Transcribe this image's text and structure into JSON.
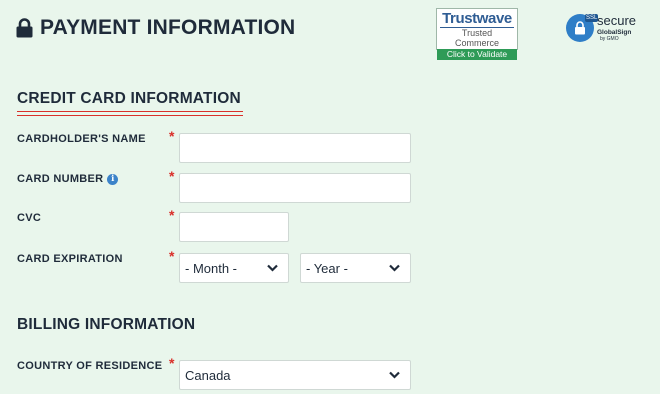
{
  "header": {
    "title": "PAYMENT INFORMATION",
    "lock_icon": "lock-icon"
  },
  "badges": {
    "trustwave": {
      "name": "Trustwave",
      "subtitle": "Trusted Commerce",
      "cta": "Click to Validate"
    },
    "globalsign": {
      "ssl": "SSL",
      "secure": "secure",
      "brand": "GlobalSign",
      "by": "by GMO"
    }
  },
  "credit_card": {
    "section_title": "CREDIT CARD INFORMATION",
    "cardholder_label": "CARDHOLDER'S NAME",
    "cardholder_value": "",
    "card_number_label": "CARD NUMBER",
    "card_number_value": "",
    "cvc_label": "CVC",
    "cvc_value": "",
    "expiration_label": "CARD EXPIRATION",
    "month_selected": "- Month -",
    "year_selected": "- Year -",
    "required_marker": "*"
  },
  "billing": {
    "section_title": "BILLING INFORMATION",
    "country_label": "COUNTRY OF RESIDENCE",
    "country_selected": "Canada"
  },
  "colors": {
    "background": "#e9f6ec",
    "accent_red": "#d9302a",
    "text": "#1f2b3a",
    "info_blue": "#3c83c9"
  }
}
